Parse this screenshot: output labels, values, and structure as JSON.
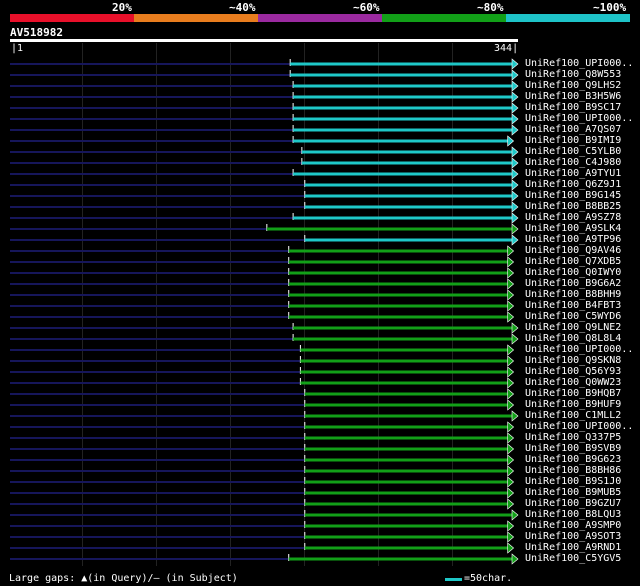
{
  "color_scale": {
    "labels": [
      "20%",
      "~40%",
      "~60%",
      "~80%",
      "~100%"
    ],
    "colors": [
      "#e8102a",
      "#e87d1e",
      "#9b2aa0",
      "#12a018",
      "#1ec3c8"
    ]
  },
  "query": {
    "name": "AV518982",
    "start": "1",
    "end": "344",
    "length": 344
  },
  "hits": [
    {
      "name": "UniRef100_UPI000..",
      "start": 192,
      "end": 344,
      "color": "#1ec8c8"
    },
    {
      "name": "UniRef100_Q8W553",
      "start": 192,
      "end": 344,
      "color": "#1ec8c8"
    },
    {
      "name": "UniRef100_Q9LHS2",
      "start": 194,
      "end": 344,
      "color": "#1ec8c8"
    },
    {
      "name": "UniRef100_B3H5W6",
      "start": 194,
      "end": 344,
      "color": "#1ec8c8"
    },
    {
      "name": "UniRef100_B9SC17",
      "start": 194,
      "end": 344,
      "color": "#1ec8c8"
    },
    {
      "name": "UniRef100_UPI000..",
      "start": 194,
      "end": 344,
      "color": "#1ec8c8"
    },
    {
      "name": "UniRef100_A7QS07",
      "start": 194,
      "end": 344,
      "color": "#1ec8c8"
    },
    {
      "name": "UniRef100_B9IMI9",
      "start": 194,
      "end": 341,
      "color": "#1ec8c8"
    },
    {
      "name": "UniRef100_C5YLB0",
      "start": 200,
      "end": 344,
      "color": "#1ec8c8"
    },
    {
      "name": "UniRef100_C4J980",
      "start": 200,
      "end": 344,
      "color": "#1ec8c8"
    },
    {
      "name": "UniRef100_A9TYU1",
      "start": 194,
      "end": 344,
      "color": "#1ec8c8"
    },
    {
      "name": "UniRef100_Q6Z9J1",
      "start": 202,
      "end": 344,
      "color": "#1ec8c8"
    },
    {
      "name": "UniRef100_B9G145",
      "start": 202,
      "end": 344,
      "color": "#1ec8c8"
    },
    {
      "name": "UniRef100_B8BB25",
      "start": 202,
      "end": 344,
      "color": "#1ec8c8"
    },
    {
      "name": "UniRef100_A9SZ78",
      "start": 194,
      "end": 344,
      "color": "#1ec8c8"
    },
    {
      "name": "UniRef100_A9SLK4",
      "start": 176,
      "end": 344,
      "color": "#12a018"
    },
    {
      "name": "UniRef100_A9TP96",
      "start": 202,
      "end": 344,
      "color": "#1ec8c8"
    },
    {
      "name": "UniRef100_Q9AV46",
      "start": 191,
      "end": 341,
      "color": "#12a018"
    },
    {
      "name": "UniRef100_Q7XDB5",
      "start": 191,
      "end": 341,
      "color": "#12a018"
    },
    {
      "name": "UniRef100_Q0IWY0",
      "start": 191,
      "end": 341,
      "color": "#12a018"
    },
    {
      "name": "UniRef100_B9G6A2",
      "start": 191,
      "end": 341,
      "color": "#12a018"
    },
    {
      "name": "UniRef100_B8BHH9",
      "start": 191,
      "end": 341,
      "color": "#12a018"
    },
    {
      "name": "UniRef100_B4FBT3",
      "start": 191,
      "end": 341,
      "color": "#12a018"
    },
    {
      "name": "UniRef100_C5WYD6",
      "start": 191,
      "end": 341,
      "color": "#12a018"
    },
    {
      "name": "UniRef100_Q9LNE2",
      "start": 194,
      "end": 344,
      "color": "#12a018"
    },
    {
      "name": "UniRef100_Q8L8L4",
      "start": 194,
      "end": 344,
      "color": "#12a018"
    },
    {
      "name": "UniRef100_UPI000..",
      "start": 199,
      "end": 341,
      "color": "#12a018"
    },
    {
      "name": "UniRef100_Q9SKN8",
      "start": 199,
      "end": 341,
      "color": "#12a018"
    },
    {
      "name": "UniRef100_Q56Y93",
      "start": 199,
      "end": 341,
      "color": "#12a018"
    },
    {
      "name": "UniRef100_Q0WW23",
      "start": 199,
      "end": 341,
      "color": "#12a018"
    },
    {
      "name": "UniRef100_B9HQB7",
      "start": 202,
      "end": 341,
      "color": "#12a018"
    },
    {
      "name": "UniRef100_B9HUF9",
      "start": 202,
      "end": 341,
      "color": "#12a018"
    },
    {
      "name": "UniRef100_C1MLL2",
      "start": 202,
      "end": 344,
      "color": "#12a018"
    },
    {
      "name": "UniRef100_UPI000..",
      "start": 202,
      "end": 341,
      "color": "#12a018"
    },
    {
      "name": "UniRef100_Q337P5",
      "start": 202,
      "end": 341,
      "color": "#12a018"
    },
    {
      "name": "UniRef100_B9SVB9",
      "start": 202,
      "end": 341,
      "color": "#12a018"
    },
    {
      "name": "UniRef100_B9G623",
      "start": 202,
      "end": 341,
      "color": "#12a018"
    },
    {
      "name": "UniRef100_B8BH86",
      "start": 202,
      "end": 341,
      "color": "#12a018"
    },
    {
      "name": "UniRef100_B9S1J0",
      "start": 202,
      "end": 341,
      "color": "#12a018"
    },
    {
      "name": "UniRef100_B9MUB5",
      "start": 202,
      "end": 341,
      "color": "#12a018"
    },
    {
      "name": "UniRef100_B9GZU7",
      "start": 202,
      "end": 341,
      "color": "#12a018"
    },
    {
      "name": "UniRef100_B8LQU3",
      "start": 202,
      "end": 344,
      "color": "#12a018"
    },
    {
      "name": "UniRef100_A9SMP0",
      "start": 202,
      "end": 341,
      "color": "#12a018"
    },
    {
      "name": "UniRef100_A9SOT3",
      "start": 202,
      "end": 341,
      "color": "#12a018"
    },
    {
      "name": "UniRef100_A9RND1",
      "start": 202,
      "end": 341,
      "color": "#12a018"
    },
    {
      "name": "UniRef100_C5YGV5",
      "start": 191,
      "end": 344,
      "color": "#12a018"
    }
  ],
  "footer": {
    "large_gaps_text": "Large gaps: ▲(in Query)/‒ (in Subject)",
    "scale_text": "=50char."
  }
}
